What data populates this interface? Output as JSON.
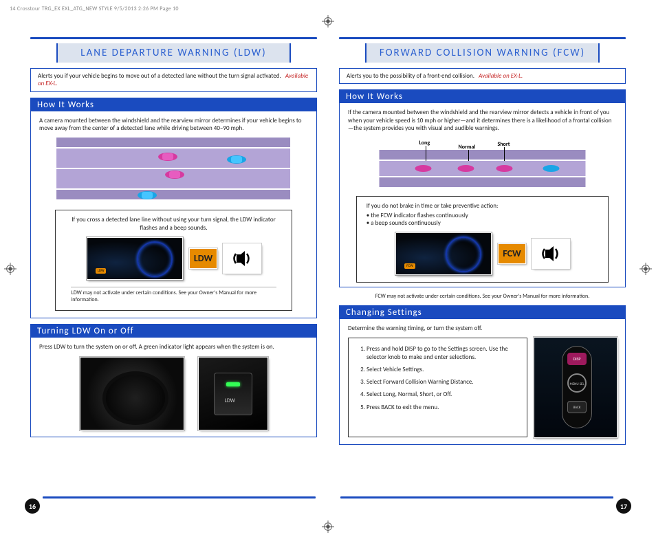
{
  "header_strip": "14 Crosstour TRG_EX EXL_ATG_NEW STYLE  9/5/2013  2:26 PM  Page 10",
  "left": {
    "title": "LANE DEPARTURE WARNING (LDW)",
    "intro": "Alerts you if your vehicle begins to move out of a detected lane without the turn signal activated.",
    "intro_availability": "Available on EX-L.",
    "how_it_works_heading": "How It Works",
    "how_it_works_body": "A camera mounted between the windshield and the rearview mirror determines if your vehicle begins to move away from the center of a detected lane while driving between 40–90 mph.",
    "inner_caption": "If you cross a detected lane line without using your turn signal, the LDW indicator flashes and a beep sounds.",
    "badge": "LDW",
    "dash_spot": "LDW",
    "footnote": "LDW may not activate under certain conditions. See your Owner's Manual for more information.",
    "turning_heading": "Turning LDW On or Off",
    "turning_body": "Press LDW to turn the system on or off.  A green indicator light appears when the system is on.",
    "ldw_button_label": "LDW",
    "page_number": "16"
  },
  "right": {
    "title": "FORWARD COLLISION WARNING (FCW)",
    "intro": "Alerts you to the possibility of a front-end collision.",
    "intro_availability": "Available on EX-L.",
    "how_it_works_heading": "How It Works",
    "how_it_works_body": "If the camera mounted between the windshield and the rearview mirror detects a vehicle in front of you when your vehicle speed is 10 mph or higher—and it determines there is a likelihood of a frontal collision—the system provides you with visual and audible warnings.",
    "distance_labels": {
      "long": "Long",
      "normal": "Normal",
      "short": "Short"
    },
    "inner_lead": "If you do not brake in time or take preventive action:",
    "inner_bullets": [
      "the FCW indicator flashes continuously",
      "a beep sounds continuously"
    ],
    "badge": "FCW",
    "dash_spot": "FCW",
    "footnote": "FCW may not activate under certain conditions. See your Owner's Manual for more information.",
    "settings_heading": "Changing Settings",
    "settings_body": "Determine the warning timing, or turn the system off.",
    "steps": [
      "Press and hold DISP to go to the Settings screen. Use the selector knob to make and enter selections.",
      "Select Vehicle Settings.",
      "Select Forward Collision Warning Distance.",
      "Select Long, Normal, Short, or Off.",
      "Press BACK to exit the menu."
    ],
    "control_labels": {
      "disp": "DISP",
      "sel": "MENU SEL",
      "back": "BACK"
    },
    "page_number": "17"
  }
}
